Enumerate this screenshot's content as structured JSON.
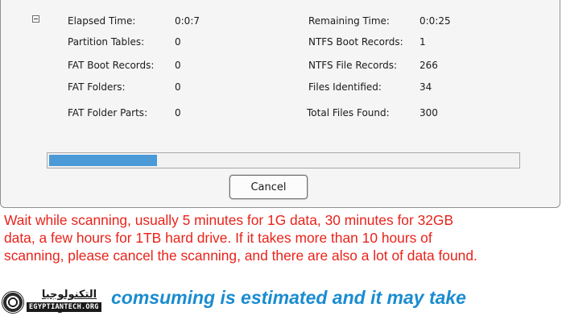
{
  "stats": {
    "elapsed_label": "Elapsed Time:",
    "elapsed_value": "0:0:7",
    "remaining_label": "Remaining Time:",
    "remaining_value": "0:0:25",
    "partition_label": "Partition Tables:",
    "partition_value": "0",
    "ntfs_boot_label": "NTFS Boot Records:",
    "ntfs_boot_value": "1",
    "fat_boot_label": "FAT Boot Records:",
    "fat_boot_value": "0",
    "ntfs_file_label": "NTFS File Records:",
    "ntfs_file_value": "266",
    "fat_folders_label": "FAT Folders:",
    "fat_folders_value": "0",
    "files_identified_label": "Files Identified:",
    "files_identified_value": "34",
    "fat_folder_parts_label": "FAT Folder Parts:",
    "fat_folder_parts_value": "0",
    "total_files_label": "Total Files Found:",
    "total_files_value": "300"
  },
  "progress": {
    "fraction": 0.23,
    "fill_color": "#4a9ad8"
  },
  "buttons": {
    "cancel_label": "Cancel"
  },
  "note": {
    "lines": [
      "Wait while scanning, usually 5 minutes for 1G data, 30 minutes for 32GB",
      "data, a few hours for 1TB hard drive. If it takes more than 10 hours of",
      "scanning, please cancel the scanning, and there are also a lot of data found."
    ],
    "color": "#e8231b"
  },
  "caption": {
    "text": "comsuming is estimated and it may take",
    "color": "#1a8cd0"
  },
  "watermark": {
    "arabic": "التكنولوجيا المصرية",
    "latin": "EGYPTIANTECH.ORG"
  }
}
